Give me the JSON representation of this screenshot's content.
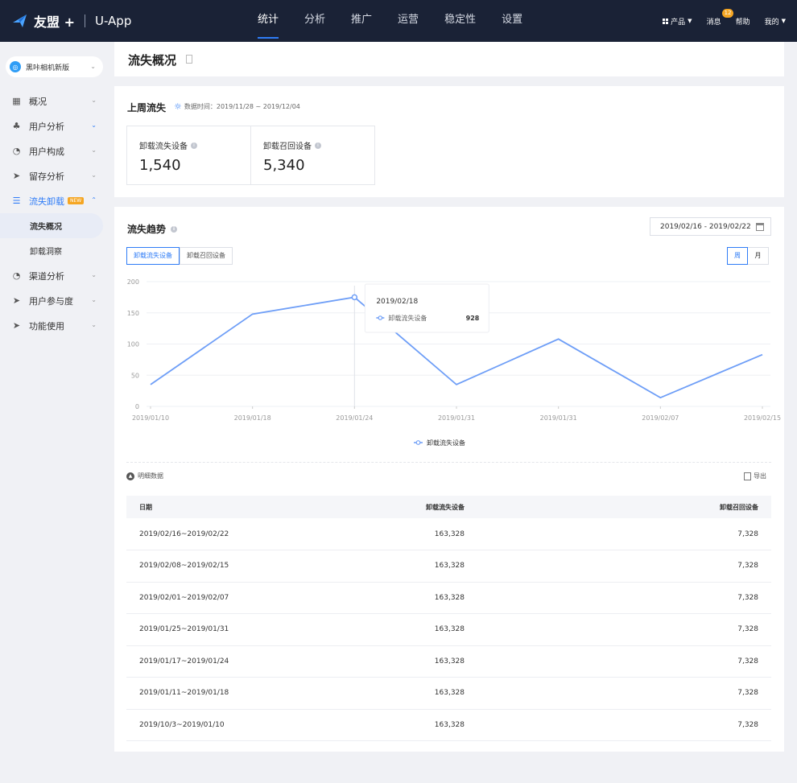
{
  "topnav": {
    "brand": "友盟 +",
    "app": "U-App",
    "tabs": [
      "统计",
      "分析",
      "推广",
      "运营",
      "稳定性",
      "设置"
    ],
    "active_tab": 0,
    "right": {
      "product": "产品",
      "messages": "消息",
      "message_count": "12",
      "help": "帮助",
      "mine": "我的"
    }
  },
  "sidebar": {
    "app_name": "黑咔相机新版",
    "items": [
      {
        "label": "概况",
        "icon": "grid-icon"
      },
      {
        "label": "用户分析",
        "icon": "users-icon"
      },
      {
        "label": "用户构成",
        "icon": "pie-icon"
      },
      {
        "label": "留存分析",
        "icon": "send-icon"
      },
      {
        "label": "流失卸载",
        "icon": "list-icon",
        "tag": "NEW"
      },
      {
        "label": "渠道分析",
        "icon": "pie-icon"
      },
      {
        "label": "用户参与度",
        "icon": "send-icon"
      },
      {
        "label": "功能使用",
        "icon": "send-icon"
      }
    ],
    "subitems": [
      "流失概况",
      "卸载洞察"
    ],
    "active_subitem": "流失概况"
  },
  "header": {
    "title": "流失概况"
  },
  "last_week": {
    "title": "上周流失",
    "data_time": "数据时间：2019/11/28 ~ 2019/12/04",
    "stats": [
      {
        "label": "卸载流失设备",
        "value": "1,540"
      },
      {
        "label": "卸载召回设备",
        "value": "5,340"
      }
    ]
  },
  "trend": {
    "title": "流失趋势",
    "date_range": "2019/02/16 - 2019/02/22",
    "tabs": [
      "卸载流失设备",
      "卸载召回设备"
    ],
    "active_tab": 0,
    "periods": [
      "周",
      "月"
    ],
    "active_period": 0,
    "tooltip": {
      "date": "2019/02/18",
      "series": "卸载流失设备",
      "value": "928"
    }
  },
  "chart_data": {
    "type": "line",
    "x": [
      "2019/01/10",
      "2019/01/18",
      "2019/01/24",
      "2019/01/31",
      "2019/01/31",
      "2019/02/07",
      "2019/02/15"
    ],
    "series": [
      {
        "name": "卸载流失设备",
        "values": [
          35,
          148,
          175,
          35,
          108,
          14,
          83
        ]
      }
    ],
    "yticks": [
      0,
      50,
      100,
      150,
      200
    ],
    "ylim": [
      0,
      200
    ],
    "legend": "bottom-center",
    "color": "#6e9ef7",
    "highlight_index": 2
  },
  "detail": {
    "toggle": "明细数据",
    "export": "导出",
    "columns": [
      "日期",
      "卸载流失设备",
      "卸载召回设备"
    ],
    "rows": [
      [
        "2019/02/16~2019/02/22",
        "163,328",
        "7,328"
      ],
      [
        "2019/02/08~2019/02/15",
        "163,328",
        "7,328"
      ],
      [
        "2019/02/01~2019/02/07",
        "163,328",
        "7,328"
      ],
      [
        "2019/01/25~2019/01/31",
        "163,328",
        "7,328"
      ],
      [
        "2019/01/17~2019/01/24",
        "163,328",
        "7,328"
      ],
      [
        "2019/01/11~2019/01/18",
        "163,328",
        "7,328"
      ],
      [
        "2019/10/3~2019/01/10",
        "163,328",
        "7,328"
      ]
    ]
  }
}
